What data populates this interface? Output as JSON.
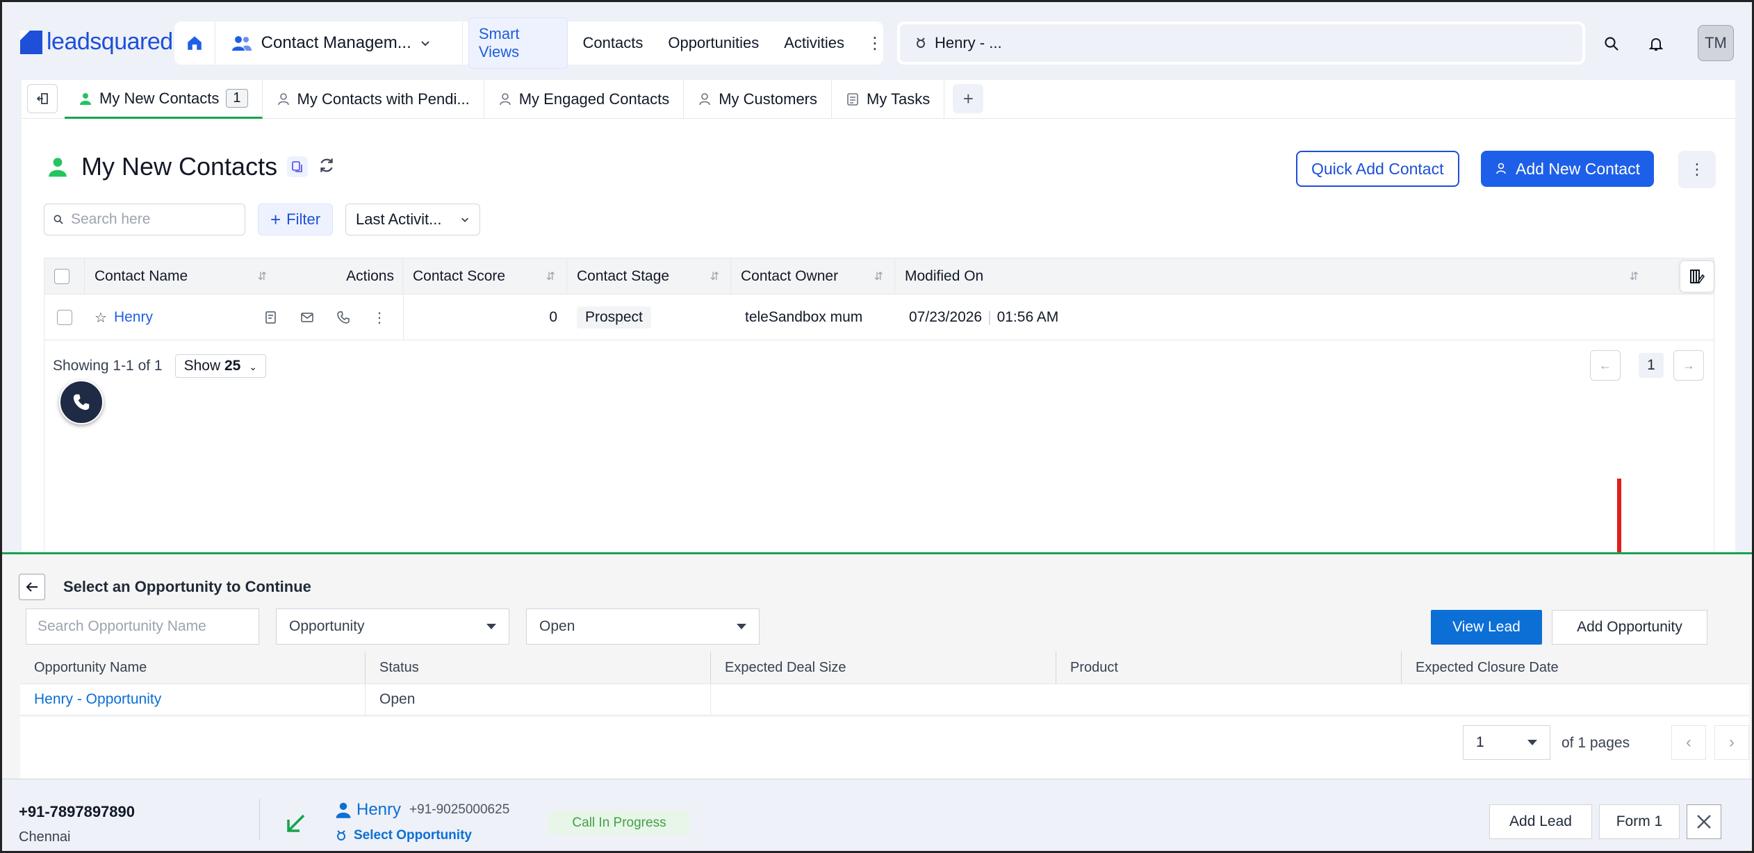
{
  "app": {
    "logo_text": "leadsquared",
    "app_switcher_label": "Contact Managem...",
    "nav_tabs": [
      "Smart Views",
      "Contacts",
      "Opportunities",
      "Activities"
    ],
    "global_search_text": "Henry - ...",
    "avatar_initials": "TM"
  },
  "tabs": [
    {
      "label": "My New Contacts",
      "count": "1"
    },
    {
      "label": "My Contacts with Pendi..."
    },
    {
      "label": "My Engaged Contacts"
    },
    {
      "label": "My Customers"
    },
    {
      "label": "My Tasks"
    }
  ],
  "page": {
    "title": "My New Contacts",
    "quick_add_label": "Quick Add Contact",
    "add_new_label": "Add New Contact",
    "search_placeholder": "Search here",
    "filter_label": "Filter",
    "sort_label": "Last Activit..."
  },
  "grid": {
    "columns": [
      "Contact Name",
      "Actions",
      "Contact Score",
      "Contact Stage",
      "Contact Owner",
      "Modified On"
    ],
    "rows": [
      {
        "name": "Henry",
        "score": "0",
        "stage": "Prospect",
        "owner": "teleSandbox mum",
        "modified_date": "07/23/2026",
        "modified_time": "01:56 AM"
      }
    ],
    "showing": "Showing 1-1 of 1",
    "show_label": "Show",
    "show_value": "25",
    "current_page": "1"
  },
  "opportunity_panel": {
    "title": "Select an Opportunity to Continue",
    "search_placeholder": "Search Opportunity Name",
    "type_select": "Opportunity",
    "status_select": "Open",
    "view_lead_label": "View Lead",
    "add_opportunity_label": "Add Opportunity",
    "columns": [
      "Opportunity Name",
      "Status",
      "Expected Deal Size",
      "Product",
      "Expected Closure Date"
    ],
    "rows": [
      {
        "name": "Henry - Opportunity",
        "status": "Open",
        "deal_size": "",
        "product": "",
        "closure_date": ""
      }
    ],
    "page_select": "1",
    "pages_text": "of 1 pages"
  },
  "call_bar": {
    "phone": "+91-7897897890",
    "city": "Chennai",
    "contact_name": "Henry",
    "contact_number": "+91-9025000625",
    "select_opportunity": "Select Opportunity",
    "status": "Call In Progress",
    "add_lead_label": "Add Lead",
    "form_label": "Form 1"
  },
  "colors": {
    "brand_blue": "#1d4fd8",
    "primary_button": "#1d5fe8",
    "success_green": "#16a34a",
    "annotation_red": "#e11d1d"
  }
}
